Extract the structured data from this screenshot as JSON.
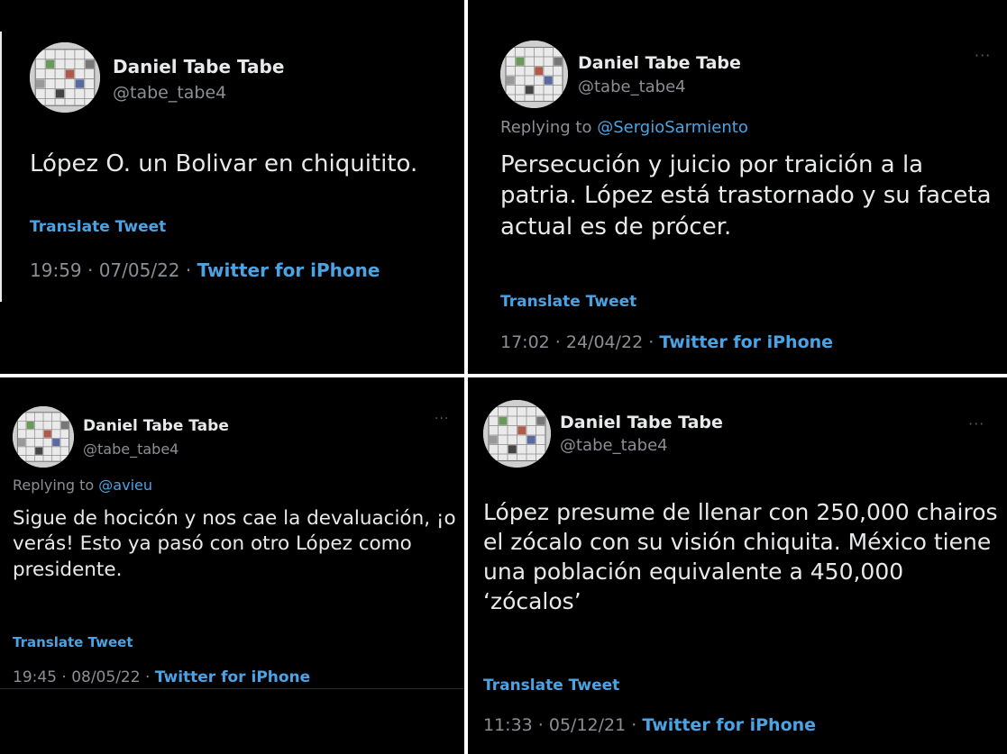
{
  "tweets": [
    {
      "name": "Daniel Tabe Tabe",
      "handle": "@tabe_tabe4",
      "text": "López O. un Bolivar en chiquitito.",
      "translate": "Translate Tweet",
      "time": "19:59 · 07/05/22 · ",
      "source": "Twitter for iPhone"
    },
    {
      "name": "Daniel Tabe Tabe",
      "handle": "@tabe_tabe4",
      "more": "···",
      "reply_prefix": "Replying to ",
      "reply_to": "@SergioSarmiento",
      "text": "Persecución y juicio por traición a la patria. López  está trastornado y su faceta actual es de prócer.",
      "translate": "Translate Tweet",
      "time": "17:02 · 24/04/22 · ",
      "source": "Twitter for iPhone"
    },
    {
      "name": "Daniel Tabe Tabe",
      "handle": "@tabe_tabe4",
      "more": "···",
      "reply_prefix": "Replying to ",
      "reply_to": "@avieu",
      "text": "Sigue de hocicón y nos cae la devaluación, ¡o verás! Esto ya pasó con otro López como presidente.",
      "translate": "Translate Tweet",
      "time": "19:45 · 08/05/22 · ",
      "source": "Twitter for iPhone"
    },
    {
      "name": "Daniel Tabe Tabe",
      "handle": "@tabe_tabe4",
      "more": "···",
      "text": "López presume de llenar con 250,000 chairos el zócalo con su visión chiquita. México tiene una población equivalente a 450,000 ‘zócalos’",
      "translate": "Translate Tweet",
      "time": "11:33 · 05/12/21 · ",
      "source": "Twitter for iPhone"
    }
  ]
}
